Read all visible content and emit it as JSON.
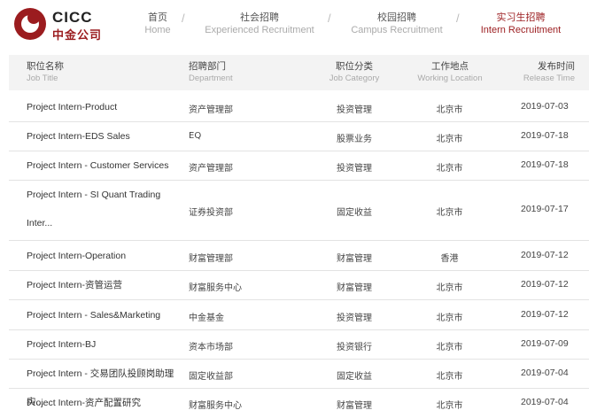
{
  "logo": {
    "en": "CICC",
    "cn": "中金公司"
  },
  "nav": [
    {
      "cn": "首页",
      "en": "Home"
    },
    {
      "cn": "社会招聘",
      "en": "Experienced Recruitment"
    },
    {
      "cn": "校园招聘",
      "en": "Campus Recruitment"
    },
    {
      "cn": "实习生招聘",
      "en": "Intern Recruitment"
    }
  ],
  "nav_separator": "/",
  "table": {
    "headers": [
      {
        "cn": "职位名称",
        "en": "Job Title"
      },
      {
        "cn": "招聘部门",
        "en": "Department"
      },
      {
        "cn": "职位分类",
        "en": "Job Category"
      },
      {
        "cn": "工作地点",
        "en": "Working Location"
      },
      {
        "cn": "发布时间",
        "en": "Release Time"
      }
    ],
    "rows": [
      {
        "title": "Project Intern-Product",
        "department": "资产管理部",
        "category": "投资管理",
        "location": "北京市",
        "date": "2019-07-03"
      },
      {
        "title": "Project Intern-EDS Sales",
        "department": "EQ",
        "category": "股票业务",
        "location": "北京市",
        "date": "2019-07-18"
      },
      {
        "title": "Project Intern - Customer Services",
        "department": "资产管理部",
        "category": "投资管理",
        "location": "北京市",
        "date": "2019-07-18"
      },
      {
        "title": "Project Intern - SI Quant Trading Inter...",
        "department": "证券投资部",
        "category": "固定收益",
        "location": "北京市",
        "date": "2019-07-17"
      },
      {
        "title": "Project Intern-Operation",
        "department": "财富管理部",
        "category": "财富管理",
        "location": "香港",
        "date": "2019-07-12"
      },
      {
        "title": "Project Intern-资管运营",
        "department": "财富服务中心",
        "category": "财富管理",
        "location": "北京市",
        "date": "2019-07-12"
      },
      {
        "title": "Project Intern - Sales&Marketing",
        "department": "中金基金",
        "category": "投资管理",
        "location": "北京市",
        "date": "2019-07-12"
      },
      {
        "title": "Project Intern-BJ",
        "department": "资本市场部",
        "category": "投资银行",
        "location": "北京市",
        "date": "2019-07-09"
      },
      {
        "title": "Project Intern - 交易团队投顾岗助理实...",
        "department": "固定收益部",
        "category": "固定收益",
        "location": "北京市",
        "date": "2019-07-04"
      },
      {
        "title": "Project Intern-资产配置研究",
        "department": "财富服务中心",
        "category": "财富管理",
        "location": "北京市",
        "date": "2019-07-04"
      }
    ]
  },
  "colors": {
    "brand": "#9b1c1f",
    "header_bg": "#f3f3f3",
    "row_border": "#e3e3e3"
  }
}
